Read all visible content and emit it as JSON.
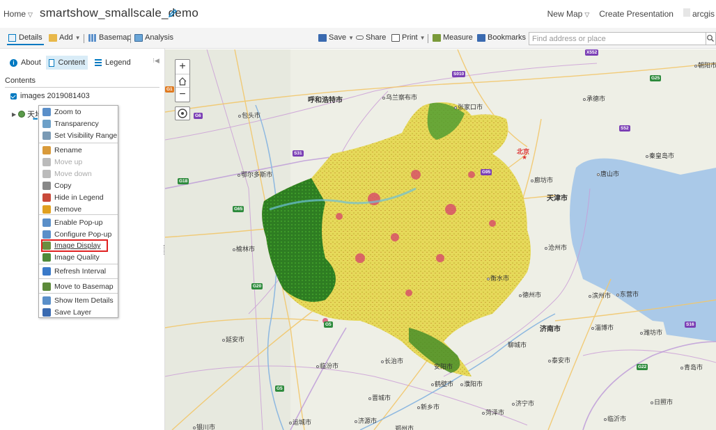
{
  "header": {
    "home": "Home",
    "map_title": "smartshow_smallscale_demo",
    "new_map": "New Map",
    "create_presentation": "Create Presentation",
    "user": "arcgis"
  },
  "toolbar": {
    "details": "Details",
    "add": "Add",
    "basemap": "Basemap",
    "analysis": "Analysis",
    "save": "Save",
    "share": "Share",
    "print": "Print",
    "measure": "Measure",
    "bookmarks": "Bookmarks",
    "search_placeholder": "Find address or place"
  },
  "panel": {
    "tabs": [
      "About",
      "Content",
      "Legend"
    ],
    "contents_label": "Contents",
    "layer_name": "images 2019081403",
    "sub_layer": "天地"
  },
  "context_menu": {
    "items": [
      {
        "label": "Zoom to",
        "icon": "zoom-icon",
        "color": "#5a8fc9"
      },
      {
        "label": "Transparency",
        "icon": "transparency-icon",
        "color": "#6da0c8"
      },
      {
        "label": "Set Visibility Range",
        "icon": "visibility-range-icon",
        "color": "#7a9ab5"
      },
      {
        "label": "Rename",
        "icon": "rename-icon",
        "color": "#d99a3a"
      },
      {
        "label": "Move up",
        "icon": "arrow-up-icon",
        "color": "#bbbbbb"
      },
      {
        "label": "Move down",
        "icon": "arrow-down-icon",
        "color": "#bbbbbb"
      },
      {
        "label": "Copy",
        "icon": "copy-icon",
        "color": "#888888"
      },
      {
        "label": "Hide in Legend",
        "icon": "hide-legend-icon",
        "color": "#c94a3a"
      },
      {
        "label": "Remove",
        "icon": "remove-icon",
        "color": "#e0a020"
      },
      {
        "label": "Enable Pop-up",
        "icon": "popup-icon",
        "color": "#5a8fc9"
      },
      {
        "label": "Configure Pop-up",
        "icon": "configure-popup-icon",
        "color": "#5a8fc9"
      },
      {
        "label": "Image Display",
        "icon": "image-display-icon",
        "color": "#6c8e3f"
      },
      {
        "label": "Image Quality",
        "icon": "image-quality-icon",
        "color": "#4f8a3a"
      },
      {
        "label": "Refresh Interval",
        "icon": "refresh-icon",
        "color": "#3a7ac9"
      },
      {
        "label": "Move to Basemap",
        "icon": "basemap-icon",
        "color": "#5c8a3a"
      },
      {
        "label": "Show Item Details",
        "icon": "details-icon",
        "color": "#5a8fc9"
      },
      {
        "label": "Save Layer",
        "icon": "save-icon",
        "color": "#3a6ab0"
      }
    ]
  },
  "map": {
    "cities": [
      "呼和浩特市",
      "乌兰察布市",
      "张家口市",
      "承德市",
      "包头市",
      "北京",
      "秦皇岛市",
      "唐山市",
      "廊坊市",
      "天津市",
      "鄂尔多斯市",
      "沧州市",
      "榆林市",
      "衡水市",
      "德州市",
      "滨州市",
      "东营市",
      "济南市",
      "淄博市",
      "潍坊市",
      "聊城市",
      "泰安市",
      "延安市",
      "临汾市",
      "长治市",
      "鹤壁市",
      "濮阳市",
      "晋城市",
      "新乡市",
      "济宁市",
      "菏泽市",
      "日照市",
      "运城市",
      "济源市",
      "临沂市",
      "青岛市",
      "银川市",
      "郑州市",
      "朝阳市",
      "安阳市"
    ],
    "roads": [
      "S010",
      "G25",
      "G6",
      "S31",
      "G95",
      "G18",
      "G65",
      "G20",
      "G5",
      "G22",
      "S16",
      "X552",
      "G1",
      "S52",
      "G5"
    ]
  }
}
